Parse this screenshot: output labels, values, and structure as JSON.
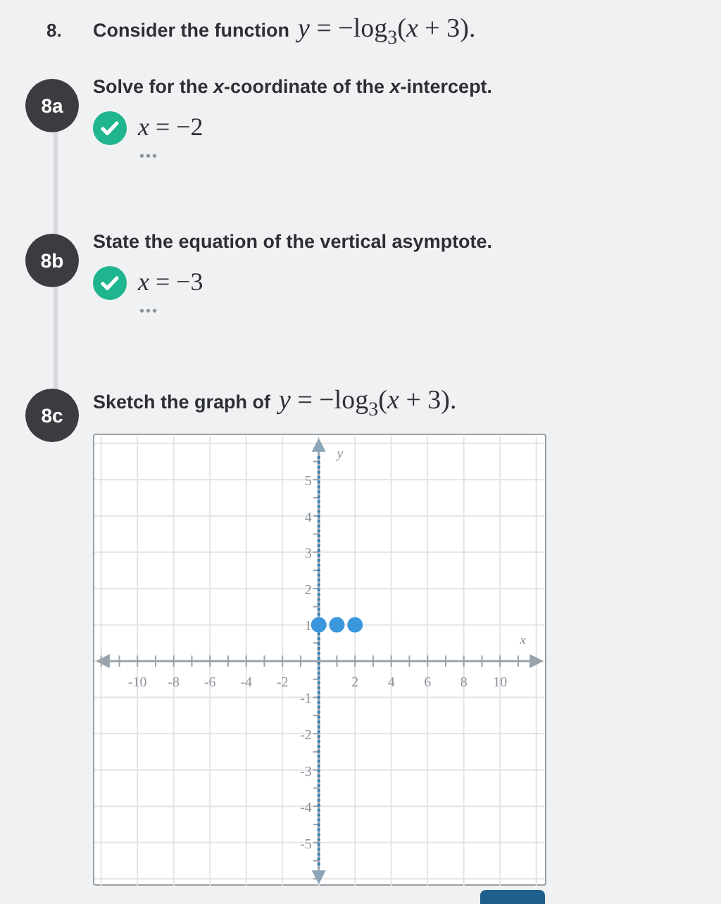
{
  "question": {
    "number": "8.",
    "prompt": "Consider the function",
    "math": "*y* = −log$_{3}$(*x* + 3)."
  },
  "parts": [
    {
      "badge": "8a",
      "prompt": "Solve for the *x*-coordinate of the *x*-intercept.",
      "answer": {
        "correct": true,
        "math": "*x* = −2",
        "more": "•••"
      }
    },
    {
      "badge": "8b",
      "prompt": "State the equation of the vertical asymptote.",
      "answer": {
        "correct": true,
        "math": "*x* = −3",
        "more": "•••"
      }
    },
    {
      "badge": "8c",
      "prompt": "Sketch the graph of",
      "math": "*y* = −log$_{3}$(*x* + 3).",
      "graph": {
        "chart_data": {
          "type": "scatter",
          "xlabel": "x",
          "ylabel": "y",
          "xlim": [
            -12.3,
            12.4
          ],
          "ylim": [
            -6.15,
            6.15
          ],
          "xticks": [
            -10,
            -8,
            -6,
            -4,
            -2,
            2,
            4,
            6,
            8,
            10
          ],
          "yticks": [
            -5,
            -4,
            -3,
            -2,
            -1,
            1,
            2,
            3,
            4,
            5
          ],
          "grid": true,
          "series": [
            {
              "color": "#3a96dd",
              "values": [
                1,
                1,
                1
              ]
            }
          ],
          "x": [
            0,
            1,
            2
          ],
          "ref_lines": [
            {
              "axis": "x",
              "value": 0,
              "color": "#3a7fb0"
            }
          ]
        }
      }
    }
  ],
  "submit_button": {
    "visible": true
  }
}
